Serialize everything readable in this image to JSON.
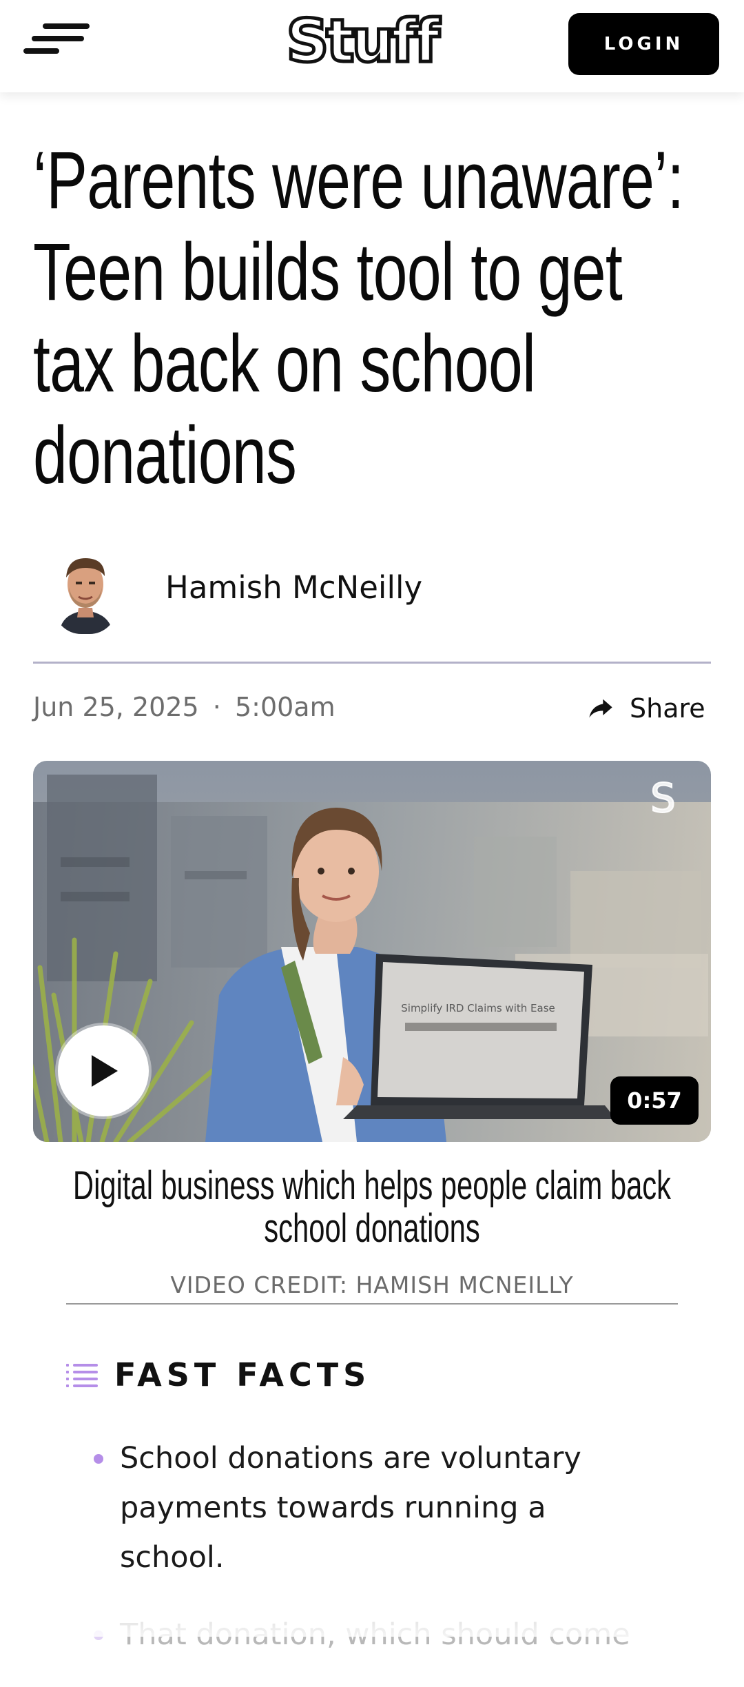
{
  "header": {
    "logo": "Stuff",
    "login_label": "LOGIN"
  },
  "article": {
    "headline": "‘Parents were unaware’: Teen builds tool to get tax back on school donations",
    "author": "Hamish McNeilly",
    "date": "Jun 25, 2025",
    "separator": "·",
    "time": "5:00am",
    "share_label": "Share"
  },
  "video": {
    "duration": "0:57",
    "watermark": "S",
    "screen_text": "Simplify IRD Claims with Ease",
    "caption": "Digital business which helps people claim back school donations",
    "credit": "VIDEO CREDIT: HAMISH MCNEILLY"
  },
  "fast_facts": {
    "title": "FAST FACTS",
    "items": [
      "School donations are voluntary payments towards running a school.",
      "That donation, which should come"
    ]
  },
  "colors": {
    "accent": "#b58ee8",
    "divider": "#b3b1c9",
    "button_bg": "#000000"
  }
}
